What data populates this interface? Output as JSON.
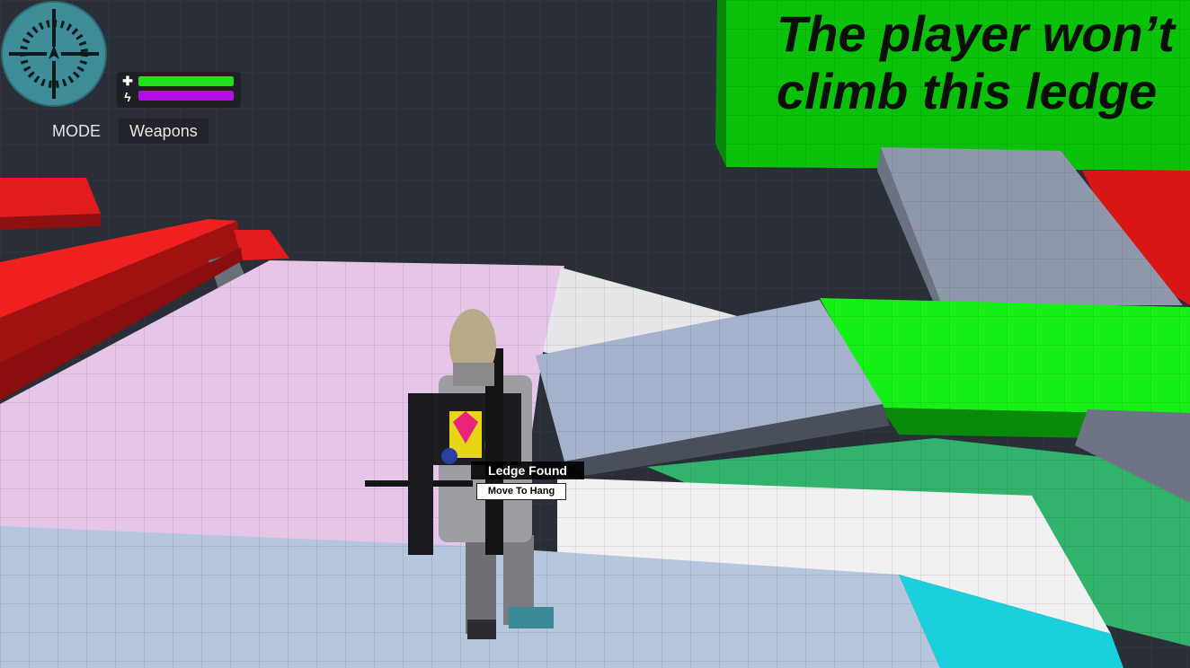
{
  "hud": {
    "mode_label": "MODE",
    "mode_value": "Weapons",
    "health": {
      "icon": "plus-icon",
      "fraction": 1.0,
      "color": "#1fe01a"
    },
    "energy": {
      "icon": "lightning-icon",
      "fraction": 1.0,
      "color": "#b30ee8"
    },
    "radar_color": "#3f8d99"
  },
  "world_sign": {
    "text": "The player won’t\nclimb this ledge",
    "color": "#0bc20b"
  },
  "prompt": {
    "title": "Ledge Found",
    "action": "Move To Hang"
  }
}
